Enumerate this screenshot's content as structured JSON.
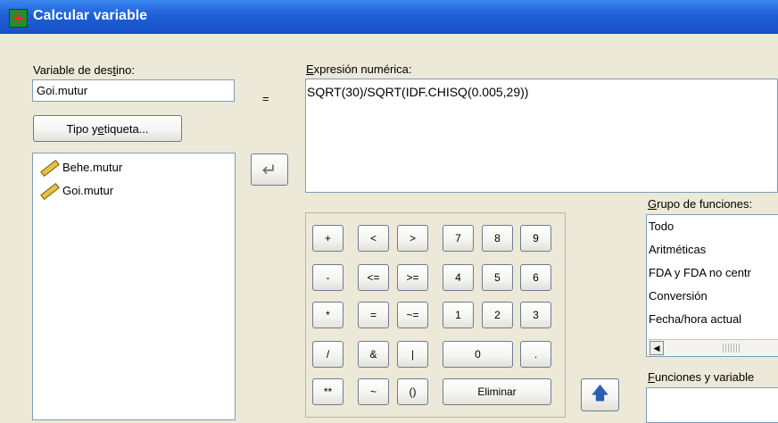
{
  "window": {
    "title": "Calcular variable"
  },
  "target": {
    "label_pre": "Variable de des",
    "label_mn": "t",
    "label_post": "ino:",
    "value": "Goi.mutur",
    "equals": "=",
    "type_button_pre": "Tipo y ",
    "type_button_mn": "e",
    "type_button_post": "tiqueta..."
  },
  "expression": {
    "label_mn": "E",
    "label_post": "xpresión numérica:",
    "value": "SQRT(30)/SQRT(IDF.CHISQ(0.005,29))"
  },
  "variables": [
    {
      "name": "Behe.mutur",
      "icon": "ruler-scale-icon"
    },
    {
      "name": "Goi.mutur",
      "icon": "ruler-scale-icon"
    }
  ],
  "keypad": {
    "rows": [
      [
        "+",
        "<",
        ">",
        "7",
        "8",
        "9"
      ],
      [
        "-",
        "<=",
        ">=",
        "4",
        "5",
        "6"
      ],
      [
        "*",
        "=",
        "~=",
        "1",
        "2",
        "3"
      ],
      [
        "/",
        "&",
        "|",
        "0",
        "."
      ],
      [
        "**",
        "~",
        "()",
        "Eliminar"
      ]
    ]
  },
  "function_group": {
    "label_mn": "G",
    "label_post": "rupo de funciones:",
    "items": [
      "Todo",
      "Aritméticas",
      "FDA y FDA no centr",
      "Conversión",
      "Fecha/hora actual"
    ]
  },
  "functions_vars": {
    "label_mn": "F",
    "label_post": "unciones y variable"
  }
}
